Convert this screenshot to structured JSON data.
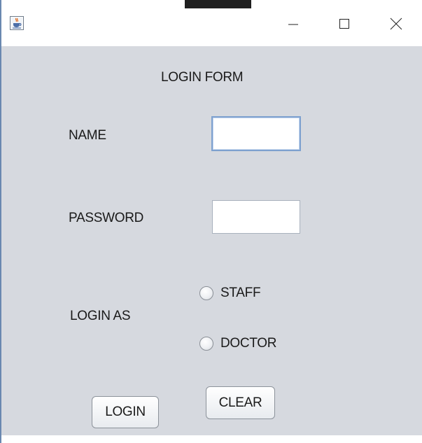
{
  "window": {
    "title": "",
    "controls": {
      "minimize": "minimize",
      "maximize": "maximize",
      "close": "close"
    }
  },
  "form": {
    "title": "LOGIN FORM",
    "name_label": "NAME",
    "name_value": "",
    "password_label": "PASSWORD",
    "password_value": "",
    "login_as_label": "LOGIN AS",
    "roles": [
      {
        "label": "STAFF",
        "selected": false
      },
      {
        "label": "DOCTOR",
        "selected": false
      }
    ],
    "login_button": "LOGIN",
    "clear_button": "CLEAR"
  },
  "icons": {
    "app": "java-coffee-cup-icon",
    "minimize": "minimize-icon",
    "maximize": "maximize-icon",
    "close": "close-icon"
  },
  "colors": {
    "form_background": "#d6d9df",
    "focused_field_border": "#7ea1cf"
  }
}
